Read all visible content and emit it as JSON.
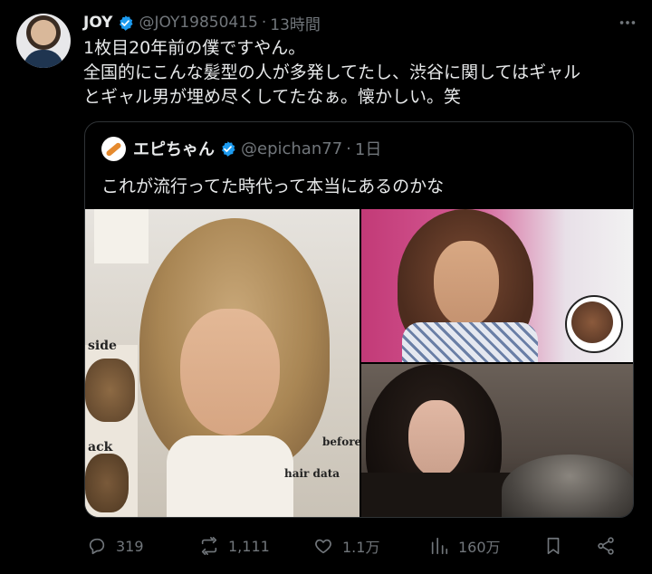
{
  "post": {
    "display_name": "JOY",
    "handle": "@JOY19850415",
    "separator": "·",
    "time": "13時間",
    "text_lines": [
      "1枚目20年前の僕ですやん。",
      "全国的にこんな髪型の人が多発してたし、渋谷に関してはギャル",
      "とギャル男が埋め尽くしてたなぁ。懐かしい。笑"
    ]
  },
  "quote": {
    "display_name": "エピちゃん",
    "handle": "@epichan77",
    "separator": "·",
    "time": "1日",
    "text": "これが流行ってた時代って本当にあるのかな",
    "photo_captions": {
      "side": "side",
      "back": "ack",
      "before": "before",
      "hair_data": "hair data"
    }
  },
  "actions": {
    "replies": "319",
    "reposts": "1,111",
    "likes": "1.1万",
    "views": "160万"
  },
  "colors": {
    "background": "#000000",
    "text": "#e7e9ea",
    "muted": "#71767b",
    "verified": "#1d9bf0",
    "border": "#2f3336"
  },
  "icons": [
    "more-icon",
    "verified-icon",
    "reply-icon",
    "repost-icon",
    "like-icon",
    "views-icon",
    "bookmark-icon",
    "share-icon"
  ]
}
